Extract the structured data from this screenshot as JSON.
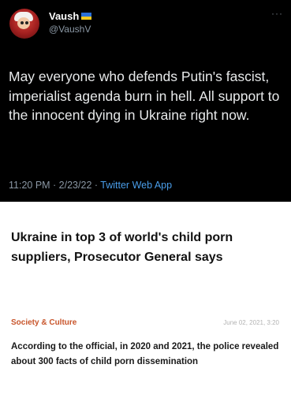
{
  "tweet": {
    "display_name": "Vaush",
    "handle": "@VaushV",
    "more_label": "···",
    "text": "May everyone who defends Putin's fascist, imperialist agenda burn in hell. All support to the innocent dying in Ukraine right now.",
    "timestamp": "11:20 PM · 2/23/22 · ",
    "app": "Twitter Web App",
    "flag_colors": {
      "top": "#2a6fd6",
      "bottom": "#f2c81e"
    }
  },
  "article": {
    "headline": "Ukraine in top 3 of world's child porn suppliers, Prosecutor General says",
    "category": "Society & Culture",
    "date": "June 02, 2021, 3:20",
    "lead": "According to the official, in 2020 and 2021, the police revealed about 300 facts of child porn dissemination",
    "category_color": "#c8552b"
  }
}
